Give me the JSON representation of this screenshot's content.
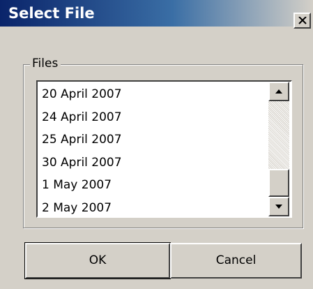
{
  "window": {
    "title": "Select File"
  },
  "group": {
    "label": "Files"
  },
  "files": [
    "20 April 2007",
    "24 April 2007",
    "25 April 2007",
    "30 April 2007",
    "1 May 2007",
    "2 May 2007"
  ],
  "buttons": {
    "ok": "OK",
    "cancel": "Cancel"
  },
  "icons": {
    "close": "close-icon",
    "scroll_up": "arrow-up-icon",
    "scroll_down": "arrow-down-icon"
  }
}
